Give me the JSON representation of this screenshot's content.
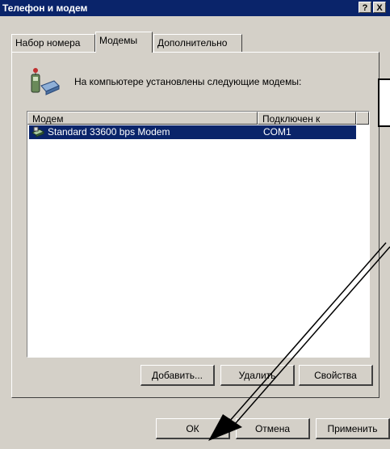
{
  "window": {
    "title": "Телефон и модем",
    "help_button": "?",
    "close_button": "X"
  },
  "tabs": [
    {
      "label": "Набор номера",
      "active": false
    },
    {
      "label": "Модемы",
      "active": true
    },
    {
      "label": "Дополнительно",
      "active": false
    }
  ],
  "modems_page": {
    "description": "На компьютере установлены следующие модемы:",
    "columns": [
      "Модем",
      "Подключен к"
    ],
    "rows": [
      {
        "modem": "Standard 33600 bps Modem",
        "port": "COM1",
        "selected": true
      }
    ],
    "add_button": "Добавить...",
    "delete_button": "Удалить",
    "properties_button": "Свойства"
  },
  "footer": {
    "ok_button": "ОК",
    "cancel_button": "Отмена",
    "apply_button": "Применить"
  },
  "colors": {
    "title_bar": "#0a246a",
    "dialog_background": "#d4d0c8",
    "selection": "#0a246a"
  }
}
